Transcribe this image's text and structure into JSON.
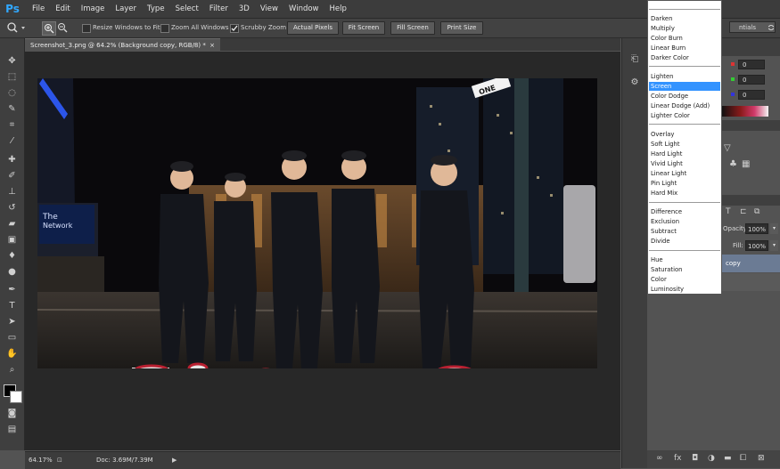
{
  "app": {
    "logo": "Ps",
    "accent": "#31a8ff"
  },
  "menubar": {
    "items": [
      "File",
      "Edit",
      "Image",
      "Layer",
      "Type",
      "Select",
      "Filter",
      "3D",
      "View",
      "Window",
      "Help"
    ]
  },
  "options_bar": {
    "tool_icon": "zoom-icon",
    "checkboxes": [
      {
        "label": "Resize Windows to Fit",
        "checked": false
      },
      {
        "label": "Zoom All Windows",
        "checked": false
      },
      {
        "label": "Scrubby Zoom",
        "checked": true
      }
    ],
    "buttons": [
      "Actual Pixels",
      "Fit Screen",
      "Fill Screen",
      "Print Size"
    ],
    "workspace": "ntials"
  },
  "document": {
    "tab_title": "Screenshot_3.png @ 64.2% (Background copy, RGB/8) *",
    "zoom": "64.17%",
    "doc_size": "Doc: 3.69M/7.39M",
    "sign_text": "ONE"
  },
  "panels": {
    "color_values": [
      "0",
      "0",
      "0"
    ],
    "opacity_label": "Opacity:",
    "opacity_value": "100%",
    "fill_label": "Fill:",
    "fill_value": "100%",
    "layer_name": "copy"
  },
  "blend_menu": {
    "selected": "Screen",
    "groups": [
      [
        "Darken",
        "Multiply",
        "Color Burn",
        "Linear Burn",
        "Darker Color"
      ],
      [
        "Lighten",
        "Screen",
        "Color Dodge",
        "Linear Dodge (Add)",
        "Lighter Color"
      ],
      [
        "Overlay",
        "Soft Light",
        "Hard Light",
        "Vivid Light",
        "Linear Light",
        "Pin Light",
        "Hard Mix"
      ],
      [
        "Difference",
        "Exclusion",
        "Subtract",
        "Divide"
      ],
      [
        "Hue",
        "Saturation",
        "Color",
        "Luminosity"
      ]
    ]
  }
}
